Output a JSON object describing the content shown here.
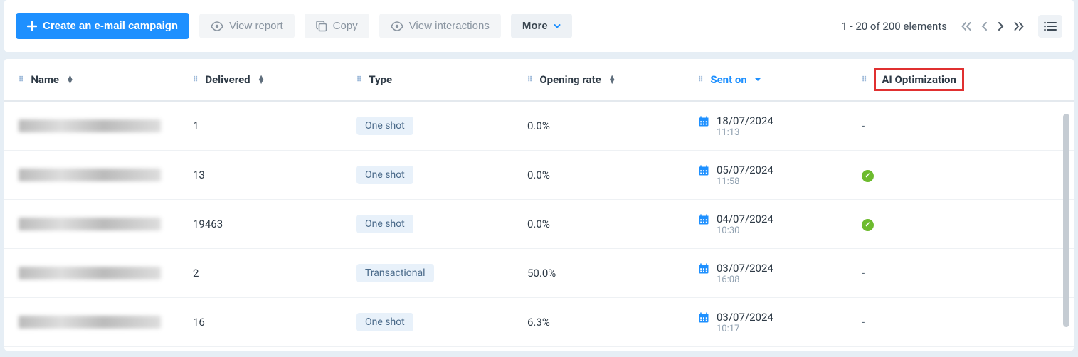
{
  "toolbar": {
    "create_label": "Create an e-mail campaign",
    "view_report_label": "View report",
    "copy_label": "Copy",
    "view_interactions_label": "View interactions",
    "more_label": "More"
  },
  "pagination": {
    "info": "1 - 20 of 200 elements"
  },
  "columns": {
    "name": "Name",
    "delivered": "Delivered",
    "type": "Type",
    "opening_rate": "Opening rate",
    "sent_on": "Sent on",
    "ai_optimization": "AI Optimization"
  },
  "type_tags": {
    "one_shot": "One shot",
    "transactional": "Transactional"
  },
  "rows": [
    {
      "delivered": "1",
      "type": "one_shot",
      "rate": "0.0%",
      "date": "18/07/2024",
      "time": "11:13",
      "ai": "-"
    },
    {
      "delivered": "13",
      "type": "one_shot",
      "rate": "0.0%",
      "date": "05/07/2024",
      "time": "11:58",
      "ai": "check"
    },
    {
      "delivered": "19463",
      "type": "one_shot",
      "rate": "0.0%",
      "date": "04/07/2024",
      "time": "10:30",
      "ai": "check"
    },
    {
      "delivered": "2",
      "type": "transactional",
      "rate": "50.0%",
      "date": "03/07/2024",
      "time": "16:08",
      "ai": "-"
    },
    {
      "delivered": "16",
      "type": "one_shot",
      "rate": "6.3%",
      "date": "03/07/2024",
      "time": "10:17",
      "ai": "-"
    }
  ]
}
